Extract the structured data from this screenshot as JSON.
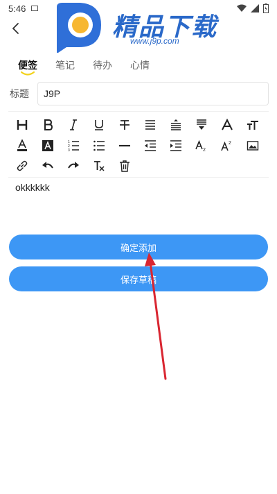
{
  "status_bar": {
    "time": "5:46"
  },
  "watermark": {
    "title": "精品下载",
    "url": "www.j9p.com"
  },
  "tabs": [
    {
      "label": "便签",
      "active": true
    },
    {
      "label": "笔记",
      "active": false
    },
    {
      "label": "待办",
      "active": false
    },
    {
      "label": "心情",
      "active": false
    }
  ],
  "title_field": {
    "label": "标题",
    "value": "J9P"
  },
  "toolbar": {
    "row1": [
      "heading-icon",
      "bold-icon",
      "italic-icon",
      "underline-icon",
      "strikethrough-icon",
      "align-justify-icon",
      "line-spacing-icon",
      "align-bottom-icon",
      "font-icon",
      "text-size-icon"
    ],
    "row2": [
      "text-color-icon",
      "text-background-icon",
      "ordered-list-icon",
      "bullet-list-icon",
      "horizontal-rule-icon",
      "outdent-icon",
      "indent-icon",
      "subscript-icon",
      "superscript-icon",
      "image-icon"
    ],
    "row3": [
      "link-icon",
      "undo-icon",
      "redo-icon",
      "clear-format-icon",
      "trash-icon"
    ]
  },
  "editor": {
    "content": "okkkkkk"
  },
  "buttons": {
    "confirm": "确定添加",
    "draft": "保存草稿"
  },
  "colors": {
    "accent": "#3d97f5",
    "tab_underline": "#f2d21b",
    "annotation_arrow": "#d92631",
    "watermark_blue": "#2a69c9"
  }
}
